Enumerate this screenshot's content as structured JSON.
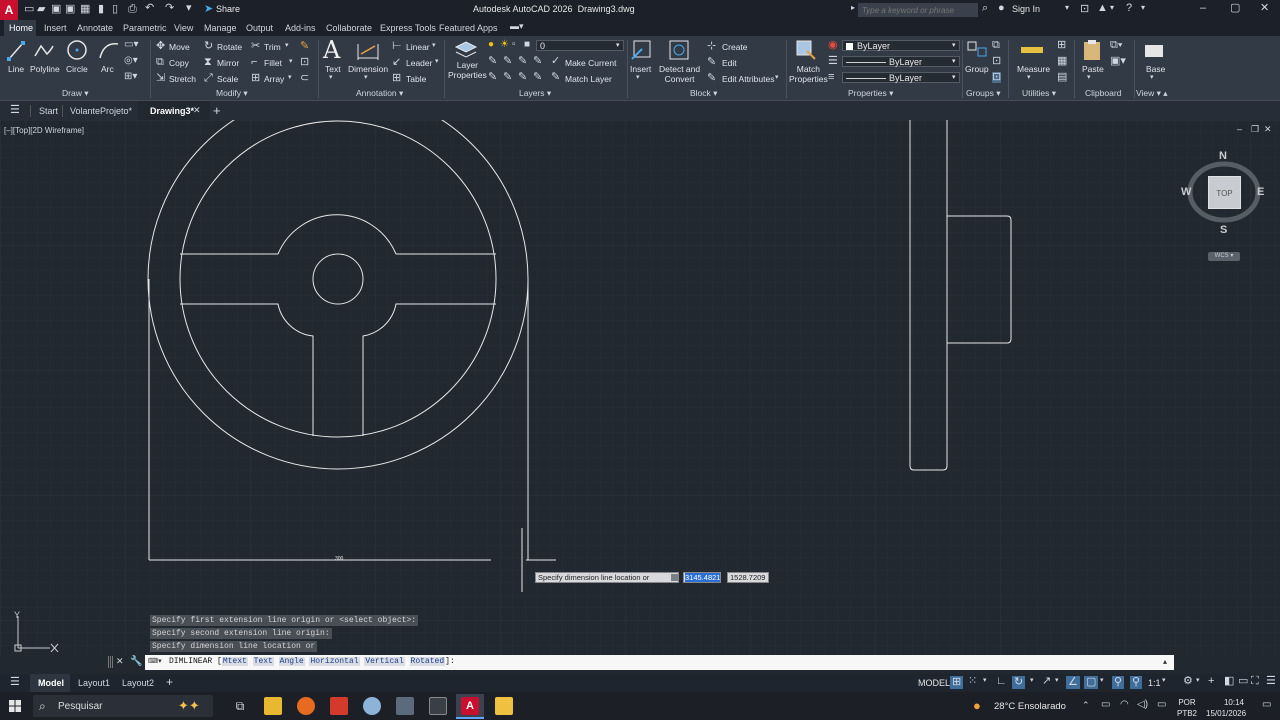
{
  "titlebar": {
    "app_title": "Autodesk AutoCAD 2026",
    "file_name": "Drawing3.dwg",
    "share_label": "Share",
    "search_placeholder": "Type a keyword or phrase",
    "sign_in": "Sign In",
    "app_button": "A"
  },
  "ribbon_tabs": [
    "Home",
    "Insert",
    "Annotate",
    "Parametric",
    "View",
    "Manage",
    "Output",
    "Add-ins",
    "Collaborate",
    "Express Tools",
    "Featured Apps"
  ],
  "ribbon": {
    "draw": {
      "label": "Draw",
      "line": "Line",
      "polyline": "Polyline",
      "circle": "Circle",
      "arc": "Arc"
    },
    "modify": {
      "label": "Modify",
      "move": "Move",
      "rotate": "Rotate",
      "trim": "Trim",
      "copy": "Copy",
      "mirror": "Mirror",
      "fillet": "Fillet",
      "stretch": "Stretch",
      "scale": "Scale",
      "array": "Array"
    },
    "annotation": {
      "label": "Annotation",
      "text": "Text",
      "dimension": "Dimension",
      "linear": "Linear",
      "leader": "Leader",
      "table": "Table"
    },
    "layers": {
      "label": "Layers",
      "layer_properties_1": "Layer",
      "layer_properties_2": "Properties",
      "current_layer": "0",
      "make_current": "Make Current",
      "match_layer": "Match Layer"
    },
    "block": {
      "label": "Block",
      "insert": "Insert",
      "detect_1": "Detect and",
      "detect_2": "Convert",
      "create": "Create",
      "edit": "Edit",
      "edit_attributes": "Edit Attributes"
    },
    "properties": {
      "label": "Properties",
      "match_1": "Match",
      "match_2": "Properties",
      "color": "ByLayer",
      "linetype": "ByLayer",
      "lineweight": "ByLayer"
    },
    "groups": {
      "label": "Groups",
      "group": "Group"
    },
    "utilities": {
      "label": "Utilities",
      "measure": "Measure"
    },
    "clipboard": {
      "label": "Clipboard",
      "paste": "Paste"
    },
    "view": {
      "label": "View",
      "base": "Base"
    }
  },
  "doc_tabs": [
    "Start",
    "VolanteProjeto*",
    "Drawing3*"
  ],
  "viewport": {
    "label": "[–][Top][2D Wireframe]",
    "viewcube": {
      "n": "N",
      "s": "S",
      "e": "E",
      "w": "W",
      "top": "TOP",
      "wcs": "WCS"
    },
    "ucs_y": "Y",
    "dim_prompt": "Specify dimension line location or",
    "dim_value_1": "3145.4821",
    "dim_value_2": "1528.7209"
  },
  "command": {
    "history": [
      "Specify first extension line origin or <select object>:",
      "Specify second extension line origin:",
      "Specify dimension line location or"
    ],
    "current_cmd": "DIMLINEAR [",
    "options": [
      "Mtext",
      "Text",
      "Angle",
      "Horizontal",
      "Vertical",
      "Rotated"
    ],
    "tail": "]:"
  },
  "layout_tabs": [
    "Model",
    "Layout1",
    "Layout2"
  ],
  "status": {
    "model": "MODEL",
    "scale": "1:1"
  },
  "taskbar": {
    "search": "Pesquisar",
    "weather_temp": "28°C",
    "weather_desc": "Ensolarado",
    "lang_1": "POR",
    "lang_2": "PTB2",
    "time": "10:14",
    "date": "15/01/2026"
  },
  "colors": {
    "accent": "#0696d7",
    "canvas": "#212830",
    "autocad_red": "#c8102e"
  }
}
